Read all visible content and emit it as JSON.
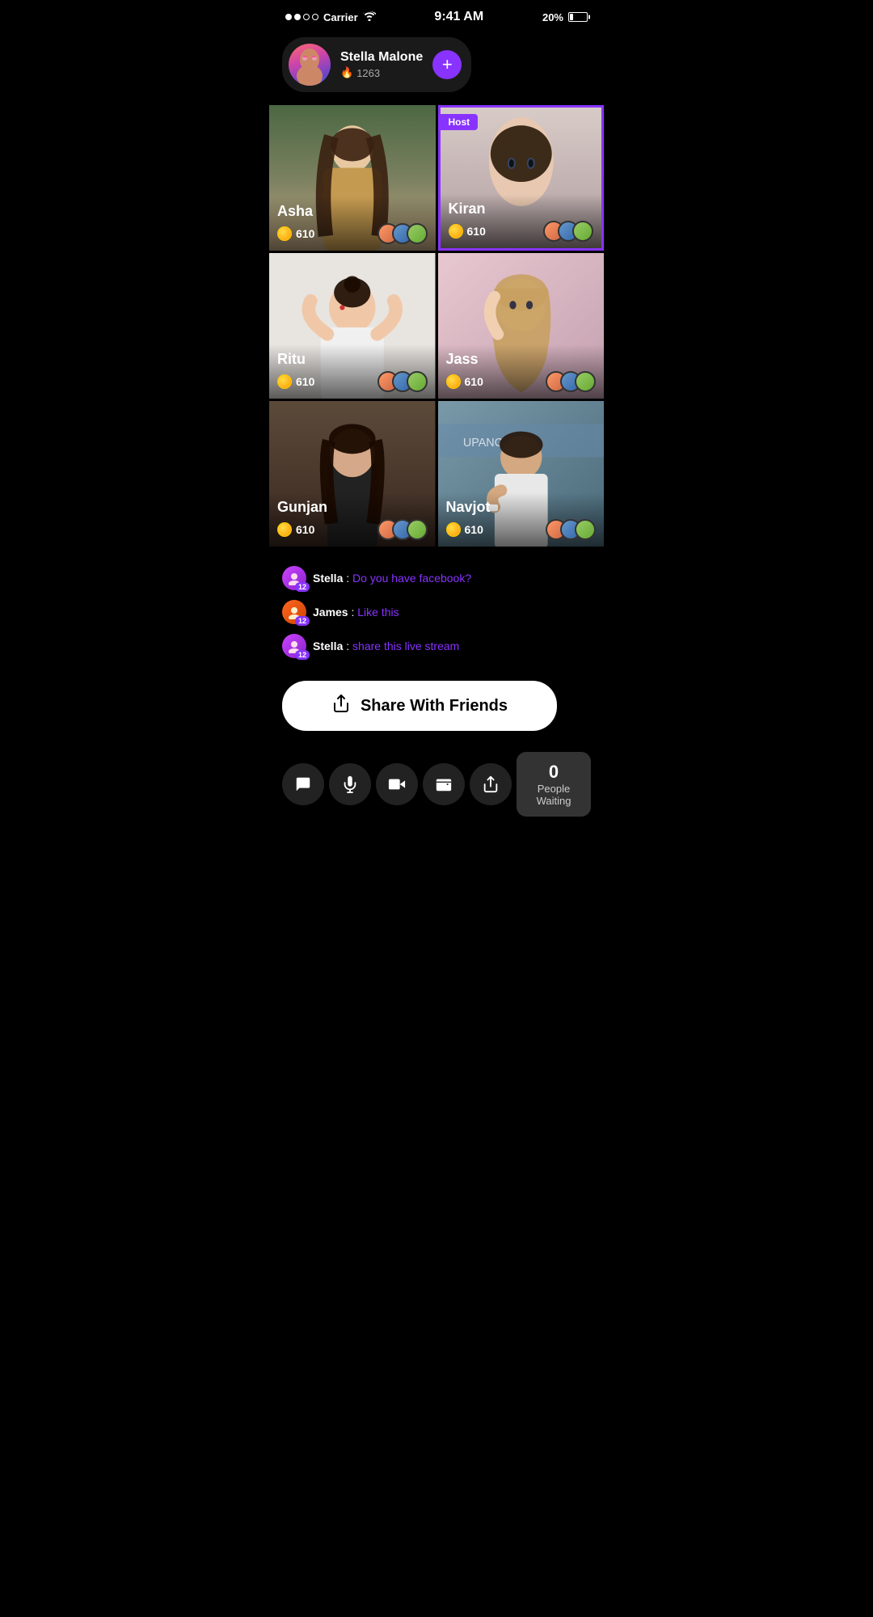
{
  "statusBar": {
    "carrier": "Carrier",
    "time": "9:41 AM",
    "battery": "20%"
  },
  "hostCard": {
    "name": "Stella Malone",
    "score": "1263",
    "addButtonLabel": "+"
  },
  "videoGrid": [
    {
      "id": "asha",
      "name": "Asha",
      "coins": "610",
      "isHost": false,
      "bgClass": "bg-asha"
    },
    {
      "id": "kiran",
      "name": "Kiran",
      "coins": "610",
      "isHost": true,
      "bgClass": "bg-kiran"
    },
    {
      "id": "ritu",
      "name": "Ritu",
      "coins": "610",
      "isHost": false,
      "bgClass": "bg-ritu"
    },
    {
      "id": "jass",
      "name": "Jass",
      "coins": "610",
      "isHost": false,
      "bgClass": "bg-jass"
    },
    {
      "id": "gunjan",
      "name": "Gunjan",
      "coins": "610",
      "isHost": false,
      "bgClass": "bg-gunjan"
    },
    {
      "id": "navjot",
      "name": "Navjot",
      "coins": "610",
      "isHost": false,
      "bgClass": "bg-navjot"
    }
  ],
  "hostBadgeLabel": "Host",
  "chat": {
    "messages": [
      {
        "avatar": "stella",
        "badge": "12",
        "username": "Stella",
        "separator": " : ",
        "message": "Do you have facebook?"
      },
      {
        "avatar": "james",
        "badge": "12",
        "username": "James",
        "separator": " : ",
        "message": "Like this"
      },
      {
        "avatar": "stella",
        "badge": "12",
        "username": "Stella",
        "separator": " : ",
        "message": "share this live stream"
      }
    ]
  },
  "shareButton": {
    "label": "Share With Friends"
  },
  "bottomBar": {
    "icons": [
      "chat",
      "mic",
      "video",
      "wallet",
      "share"
    ],
    "peopleWaiting": {
      "count": "0",
      "label": "People Waiting"
    }
  }
}
